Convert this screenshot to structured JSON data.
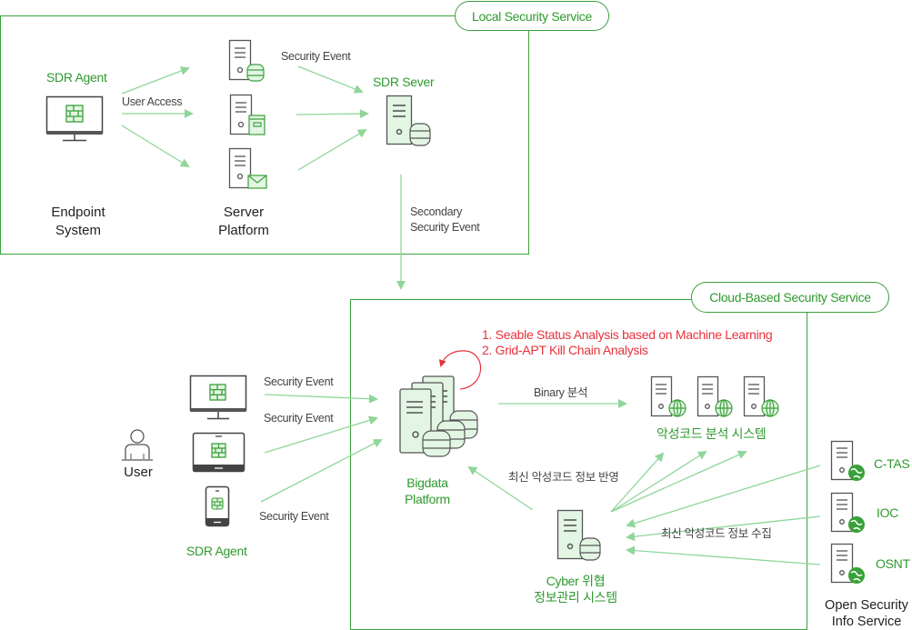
{
  "local_service": {
    "title": "Local Security Service",
    "endpoint": {
      "agent_label": "SDR Agent",
      "name_line1": "Endpoint",
      "name_line2": "System"
    },
    "user_access_label": "User Access",
    "server_platform": {
      "name_line1": "Server",
      "name_line2": "Platform"
    },
    "security_event_label": "Security Event",
    "sdr_server_label": "SDR Sever",
    "secondary_event_line1": "Secondary",
    "secondary_event_line2": "Security Event"
  },
  "cloud_service": {
    "title": "Cloud-Based Security Service",
    "analysis_items": [
      "1. Seable Status Analysis based on Machine Learning",
      "2. Grid-APT Kill Chain Analysis"
    ],
    "bigdata_line1": "Bigdata",
    "bigdata_line2": "Platform",
    "binary_label": "Binary 분석",
    "malware_system_label": "악성코드 분석 시스템",
    "reflect_label": "최신 악성코드 정보 반영",
    "collect_label": "최신 악성코드 정보 수집",
    "cyber_line1": "Cyber 위협",
    "cyber_line2": "정보관리 시스템"
  },
  "user_side": {
    "user_label": "User",
    "agent_label": "SDR Agent",
    "event_labels": [
      "Security Event",
      "Security Event",
      "Security Event"
    ]
  },
  "open_security": {
    "sources": [
      "C-TAS",
      "IOC",
      "OSNT"
    ],
    "title_line1": "Open Security",
    "title_line2": "Info Service"
  },
  "colors": {
    "brand_green": "#2e9a2e",
    "arrow_green": "#8fd69a",
    "icon_fill": "#e3f5e3",
    "highlight_red": "#e8323c"
  }
}
